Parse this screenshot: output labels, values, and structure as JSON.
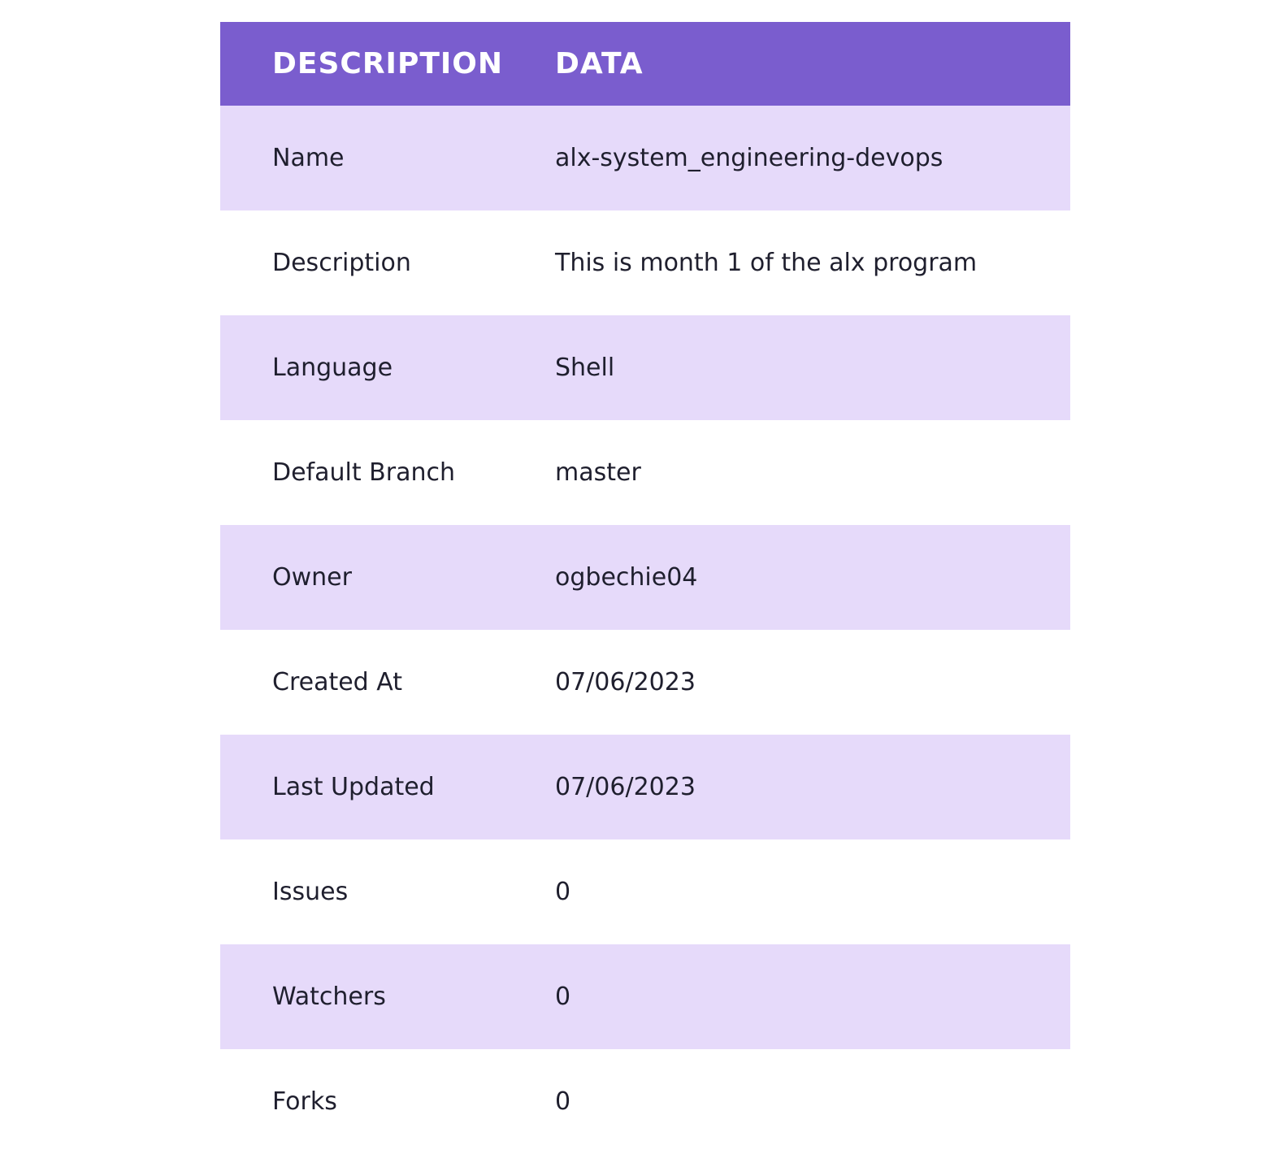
{
  "table": {
    "headers": [
      "DESCRIPTION",
      "DATA"
    ],
    "rows": [
      {
        "label": "Name",
        "value": "alx-system_engineering-devops"
      },
      {
        "label": "Description",
        "value": "This is month 1 of the alx program"
      },
      {
        "label": "Language",
        "value": "Shell"
      },
      {
        "label": "Default Branch",
        "value": "master"
      },
      {
        "label": "Owner",
        "value": "ogbechie04"
      },
      {
        "label": "Created At",
        "value": "07/06/2023"
      },
      {
        "label": "Last Updated",
        "value": "07/06/2023"
      },
      {
        "label": "Issues",
        "value": "0"
      },
      {
        "label": "Watchers",
        "value": "0"
      },
      {
        "label": "Forks",
        "value": "0"
      }
    ]
  },
  "colors": {
    "header_bg": "#7a5dce",
    "header_text": "#ffffff",
    "row_alt_bg": "#e6dafa",
    "row_bg": "#ffffff",
    "text": "#1f1f2e"
  }
}
